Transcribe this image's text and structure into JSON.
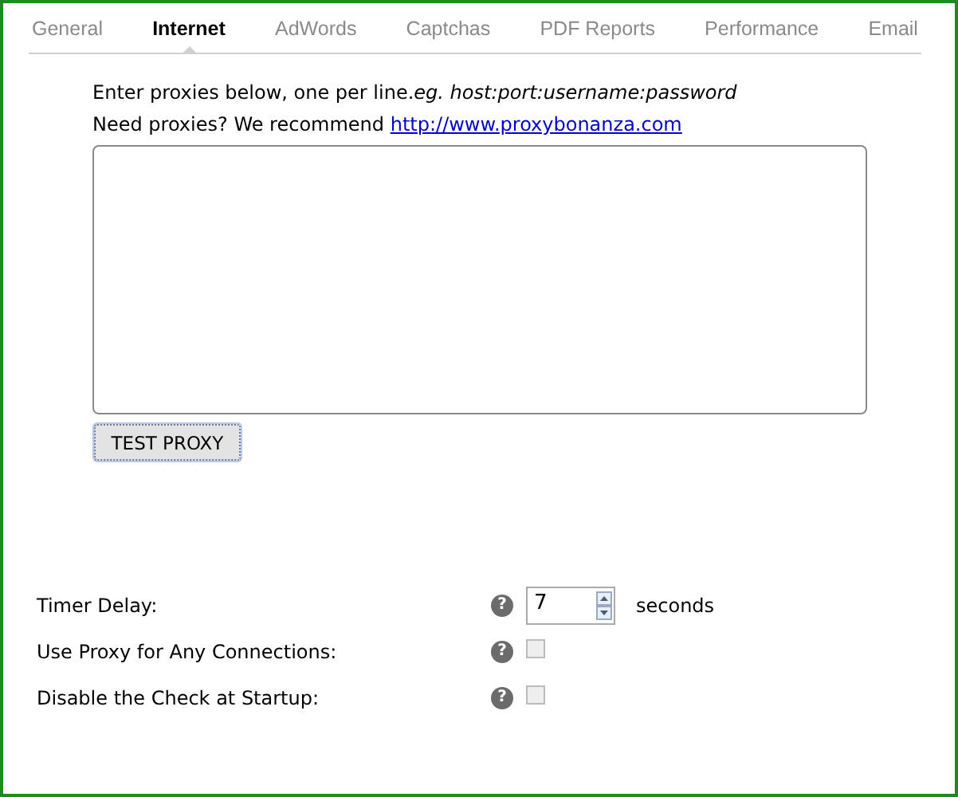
{
  "tabs": [
    {
      "label": "General",
      "selected": false
    },
    {
      "label": "Internet",
      "selected": true
    },
    {
      "label": "AdWords",
      "selected": false
    },
    {
      "label": "Captchas",
      "selected": false
    },
    {
      "label": "PDF Reports",
      "selected": false
    },
    {
      "label": "Performance",
      "selected": false
    },
    {
      "label": "Email",
      "selected": false
    }
  ],
  "intro": "Enter proxies below, one per line.*eg. host:port:username:password*",
  "recommend": {
    "text": "Need proxies? We recommend",
    "link": "http://www.proxybonanza.com"
  },
  "test_button": "TEST PROXY",
  "settings": [
    {
      "kind": "number",
      "label": "Timer Delay:",
      "help": "?",
      "value": "7",
      "unit": "seconds"
    },
    {
      "kind": "checkbox",
      "label": "Use Proxy for Any Connections:",
      "help": "?",
      "checked": false
    },
    {
      "kind": "checkbox",
      "label": "Disable the Check at Startup:",
      "help": "?",
      "checked": false
    }
  ]
}
